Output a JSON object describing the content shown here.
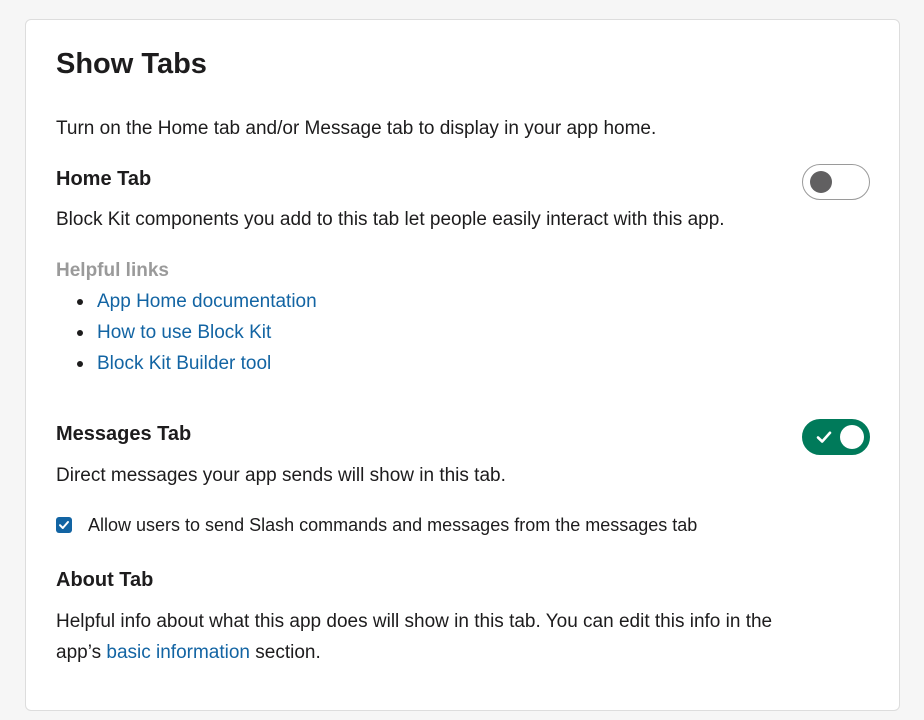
{
  "section": {
    "title": "Show Tabs",
    "intro": "Turn on the Home tab and/or Message tab to display in your app home."
  },
  "home_tab": {
    "heading": "Home Tab",
    "description": "Block Kit components you add to this tab let people easily interact with this app.",
    "toggle_state": "off",
    "helpful_links_label": "Helpful links",
    "links": [
      "App Home documentation",
      "How to use Block Kit",
      "Block Kit Builder tool"
    ]
  },
  "messages_tab": {
    "heading": "Messages Tab",
    "description": "Direct messages your app sends will show in this tab.",
    "toggle_state": "on",
    "checkbox_label": "Allow users to send Slash commands and messages from the messages tab",
    "checkbox_checked": true
  },
  "about_tab": {
    "heading": "About Tab",
    "description_line1": "Helpful info about what this app does will show in this tab. You can edit this info in the",
    "description_prefix": "app’s",
    "description_link": "basic information",
    "description_suffix": "section."
  },
  "colors": {
    "link": "#1264a3",
    "toggle_on": "#007a5a",
    "muted": "#9a9a9a"
  },
  "icons": {
    "toggle_on_check": "checkmark-icon",
    "checkbox_check": "checkmark-icon"
  }
}
